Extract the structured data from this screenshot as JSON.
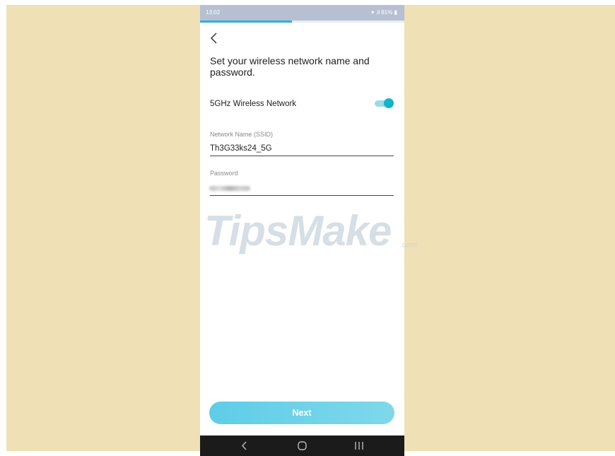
{
  "status_bar": {
    "time": "13:02",
    "battery": "81%"
  },
  "progress": 0.45,
  "page": {
    "title": "Set your wireless network name and password."
  },
  "wireless": {
    "label": "5GHz Wireless Network",
    "enabled": true
  },
  "ssid": {
    "label": "Network Name (SSID)",
    "value": "Th3G33ks24_5G"
  },
  "password": {
    "label": "Password"
  },
  "next_label": "Next",
  "watermark": {
    "brand": "TipsMake",
    "suffix": ".com"
  },
  "colors": {
    "accent": "#13b2cf",
    "background": "#efe1b5"
  }
}
